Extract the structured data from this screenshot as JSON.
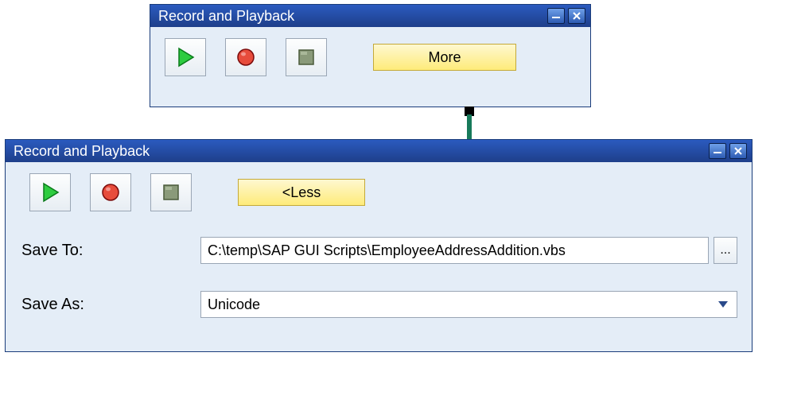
{
  "top_dialog": {
    "title": "Record and Playback",
    "more_label": "More"
  },
  "bottom_dialog": {
    "title": "Record and Playback",
    "less_label": "<Less",
    "save_to_label": "Save To:",
    "save_to_value": "C:\\temp\\SAP GUI Scripts\\EmployeeAddressAddition.vbs",
    "browse_label": "...",
    "save_as_label": "Save As:",
    "save_as_value": "Unicode"
  }
}
